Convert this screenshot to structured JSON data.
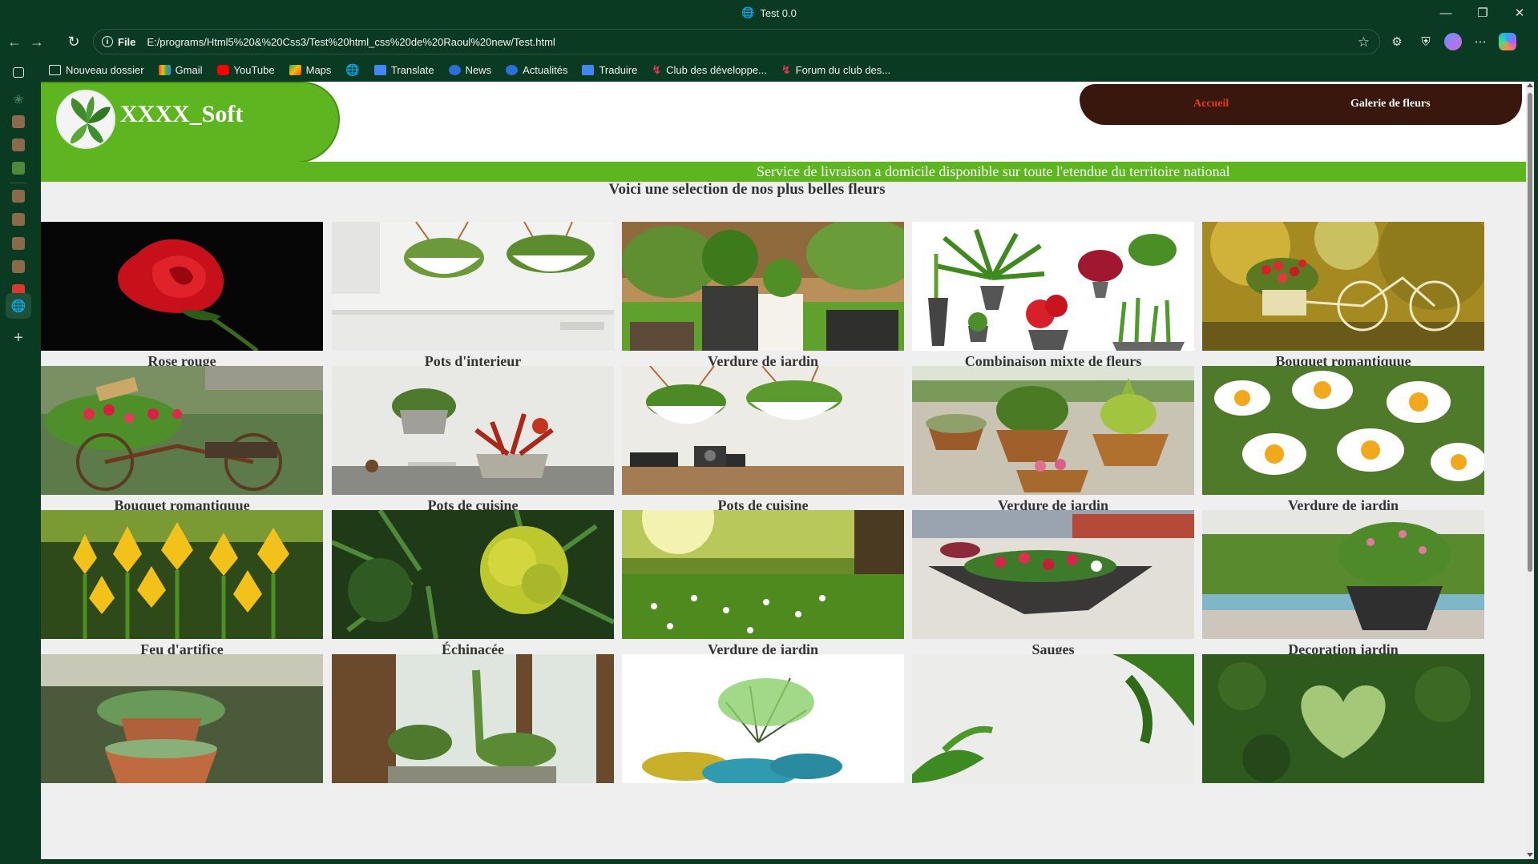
{
  "browser": {
    "tab_title": "Test 0.0",
    "address_protocol": "File",
    "address_url": "E:/programs/Html5%20&%20Css3/Test%20html_css%20de%20Raoul%20new/Test.html",
    "bookmarks": [
      {
        "label": "Nouveau dossier",
        "icon": "folder-icon"
      },
      {
        "label": "Gmail",
        "icon": "gmail-icon"
      },
      {
        "label": "YouTube",
        "icon": "youtube-icon"
      },
      {
        "label": "Maps",
        "icon": "maps-icon"
      },
      {
        "label": "",
        "icon": "globe-icon"
      },
      {
        "label": "Translate",
        "icon": "translate-icon"
      },
      {
        "label": "News",
        "icon": "news-icon"
      },
      {
        "label": "Actualités",
        "icon": "news-icon"
      },
      {
        "label": "Traduire",
        "icon": "translate-icon"
      },
      {
        "label": "Club des développe...",
        "icon": "club-icon"
      },
      {
        "label": "Forum du club des...",
        "icon": "club-icon"
      }
    ]
  },
  "page": {
    "brand": "XXXX_Soft",
    "menu": [
      "Accueil",
      "Galerie de fleurs"
    ],
    "ticker": "Service de livraison a domicile disponible sur toute l'etendue du territoire national",
    "intro": "Voici une selection de nos plus belles fleurs",
    "gallery": [
      "Rose rouge",
      "Pots d'interieur",
      "Verdure de jardin",
      "Combinaison mixte de fleurs",
      "Bouquet romantiquue",
      "Bouquet romantiquue",
      "Pots de cuisine",
      "Pots de cuisine",
      "Verdure de jardin",
      "Verdure de jardin",
      "Feu d'artifice",
      "Échinacée",
      "Verdure de jardin",
      "Sauges",
      "Decoration jardin",
      "",
      "",
      "",
      "",
      ""
    ]
  },
  "colors": {
    "browser_chrome": "#0b3a23",
    "brand_green": "#5db520",
    "menu_brown": "#3a170c",
    "active_menu": "#e23a1f"
  }
}
